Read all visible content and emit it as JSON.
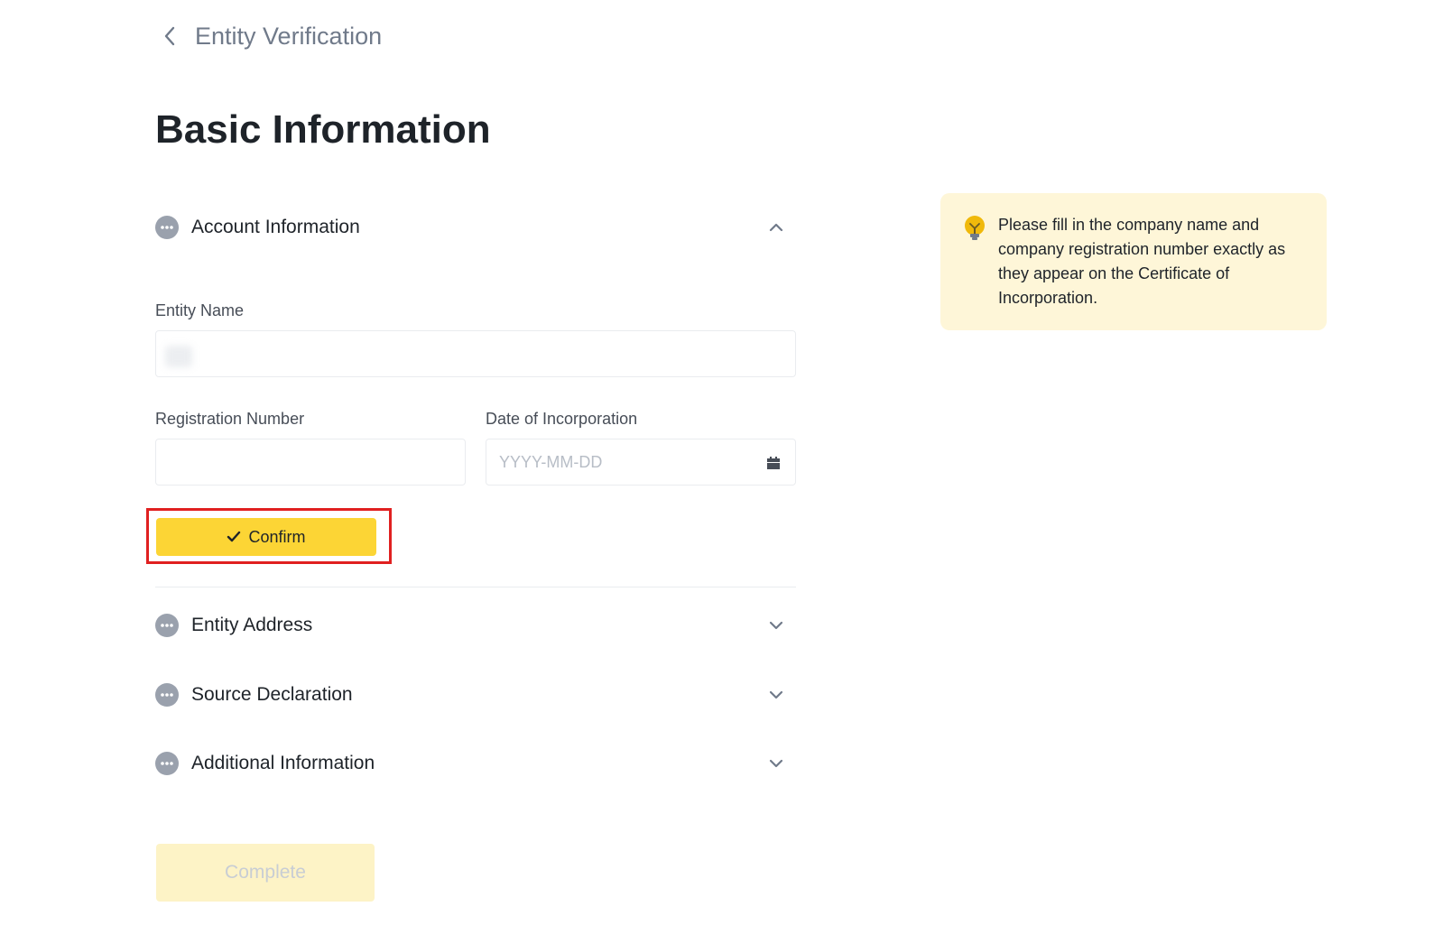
{
  "header": {
    "title": "Entity Verification"
  },
  "page": {
    "title": "Basic Information"
  },
  "sections": {
    "account": {
      "label": "Account Information"
    },
    "address": {
      "label": "Entity Address"
    },
    "source": {
      "label": "Source Declaration"
    },
    "additional": {
      "label": "Additional Information"
    }
  },
  "form": {
    "entity_name": {
      "label": "Entity Name",
      "value": ""
    },
    "registration_number": {
      "label": "Registration Number",
      "value": ""
    },
    "date_of_incorporation": {
      "label": "Date of Incorporation",
      "placeholder": "YYYY-MM-DD"
    }
  },
  "buttons": {
    "confirm_label": "Confirm",
    "complete_label": "Complete"
  },
  "tip": {
    "text": "Please fill in the company name and company registration number exactly as they appear on the Certificate of Incorporation."
  },
  "colors": {
    "accent": "#fcd535",
    "accent_disabled": "#fdf3c6",
    "tip_background": "#fef6d8",
    "highlight": "#e02020",
    "status_icon": "#9aa1ad"
  },
  "icons": {
    "back": "chevron-left-icon",
    "status": "ellipsis-circle-icon",
    "expand": "chevron-down-icon",
    "collapse": "chevron-up-icon",
    "calendar": "calendar-icon",
    "confirm": "checkmark-icon",
    "tip": "lightbulb-icon"
  }
}
